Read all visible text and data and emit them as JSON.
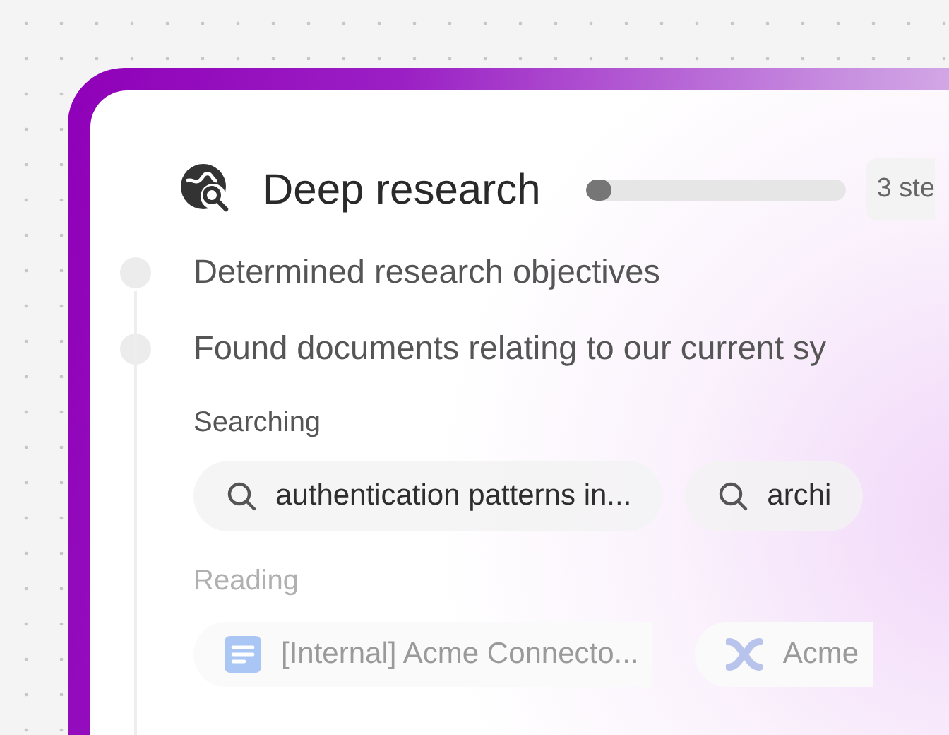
{
  "header": {
    "title": "Deep research",
    "progress": {
      "level": 0.1
    },
    "steps_badge": "3 ste"
  },
  "steps": [
    "Determined research objectives",
    "Found documents relating to our current sy"
  ],
  "searching": {
    "label": "Searching",
    "queries": [
      "authentication patterns in...",
      "archi"
    ]
  },
  "reading": {
    "label": "Reading",
    "documents": [
      {
        "title": "[Internal] Acme Connecto...",
        "kind": "doc"
      },
      {
        "title": "Acme",
        "kind": "cross"
      }
    ]
  }
}
